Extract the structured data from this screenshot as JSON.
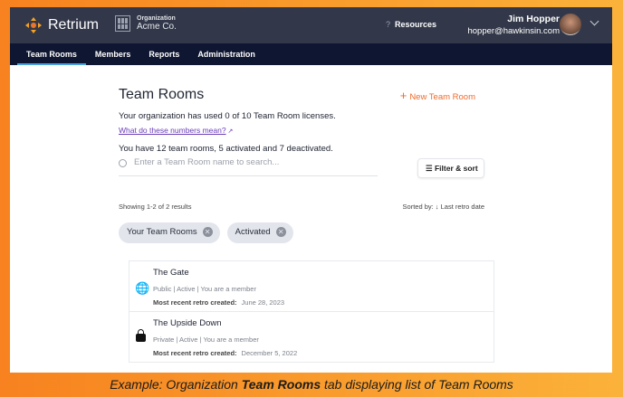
{
  "header": {
    "app_name": "Retrium",
    "org_label": "Organization",
    "org_name": "Acme Co.",
    "resources": "Resources",
    "user_name": "Jim Hopper",
    "user_email": "hopper@hawkinsin.com"
  },
  "nav": [
    "Team Rooms",
    "Members",
    "Reports",
    "Administration"
  ],
  "main": {
    "title": "Team Rooms",
    "new_button": "New Team Room",
    "licenses": "Your organization has used 0 of 10 Team Room licenses.",
    "help_link": "What do these numbers mean?",
    "summary": "You have 12 team rooms, 5 activated and 7 deactivated.",
    "search_placeholder": "Enter a Team Room name to search...",
    "filter_button": "Filter & sort",
    "showing": "Showing 1-2 of 2 results",
    "sorted": "Sorted by: ↓ Last retro date",
    "chips": [
      "Your Team Rooms",
      "Activated"
    ]
  },
  "rooms": [
    {
      "name": "The Gate",
      "meta": "Public | Active | You are a member",
      "date_label": "Most recent retro created:",
      "date": "June 28, 2023"
    },
    {
      "name": "The Upside Down",
      "meta": "Private | Active | You are a member",
      "date_label": "Most recent retro created:",
      "date": "December 5, 2022"
    }
  ],
  "caption": {
    "pre": "Example: Organization ",
    "bold": "Team Rooms",
    "post": " tab displaying list of Team Rooms"
  }
}
